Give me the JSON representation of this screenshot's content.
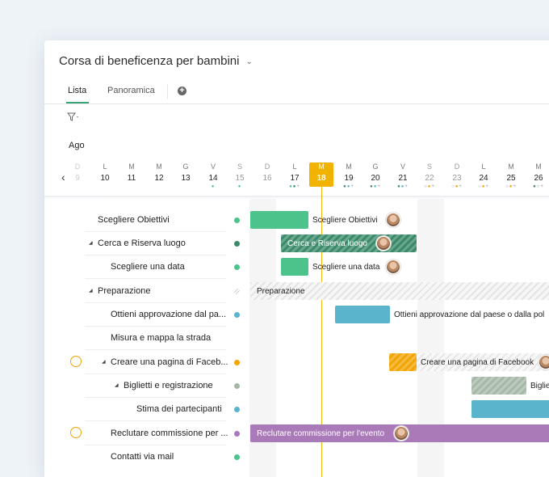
{
  "header": {
    "title": "Corsa di beneficenza per bambini"
  },
  "tabs": [
    {
      "label": "Lista"
    },
    {
      "label": "Panoramica"
    }
  ],
  "toolbar": {
    "filter_icon": "filter-icon",
    "add_icon": "plus-icon"
  },
  "timeline": {
    "month": "Ago",
    "today_color": "#f2b200",
    "days": [
      {
        "letter": "D",
        "num": "9"
      },
      {
        "letter": "L",
        "num": "10"
      },
      {
        "letter": "M",
        "num": "11"
      },
      {
        "letter": "M",
        "num": "12"
      },
      {
        "letter": "G",
        "num": "13"
      },
      {
        "letter": "V",
        "num": "14"
      },
      {
        "letter": "S",
        "num": "15"
      },
      {
        "letter": "D",
        "num": "16"
      },
      {
        "letter": "L",
        "num": "17"
      },
      {
        "letter": "M",
        "num": "18"
      },
      {
        "letter": "M",
        "num": "19"
      },
      {
        "letter": "G",
        "num": "20"
      },
      {
        "letter": "V",
        "num": "21"
      },
      {
        "letter": "S",
        "num": "22"
      },
      {
        "letter": "D",
        "num": "23"
      },
      {
        "letter": "L",
        "num": "24"
      },
      {
        "letter": "M",
        "num": "25"
      },
      {
        "letter": "M",
        "num": "26"
      }
    ]
  },
  "tasks": [
    {
      "name": "Scegliere Obiettivi",
      "status_color": "#4cc38a",
      "bar_label": "Scegliere Obiettivi"
    },
    {
      "name": "Cerca e Riserva luogo",
      "status_color": "#3a8a6a",
      "bar_label": "Cerca e Riserva luogo"
    },
    {
      "name": "Scegliere una data",
      "status_color": "#4cc38a",
      "bar_label": "Scegliere una data"
    },
    {
      "name": "Preparazione",
      "status_color": "#e6e6e6",
      "bar_label": "Preparazione"
    },
    {
      "name": "Ottieni approvazione dal pa...",
      "status_color": "#5ab4cc",
      "bar_label": "Ottieni approvazione dal paese o dalla pol"
    },
    {
      "name": "Misura e mappa la strada",
      "status_color": "",
      "bar_label": ""
    },
    {
      "name": "Creare una pagina di Faceb...",
      "status_color": "#f2a400",
      "bar_label": "Creare una pagina di Facebook"
    },
    {
      "name": "Biglietti e registrazione",
      "status_color": "#a5b8a8",
      "bar_label": "Biglie"
    },
    {
      "name": "Stima dei partecipanti",
      "status_color": "#5ab4cc",
      "bar_label": ""
    },
    {
      "name": "Reclutare commissione per ...",
      "status_color": "#a979b8",
      "bar_label": "Reclutare commissione per l'evento"
    },
    {
      "name": "Contatti via mail",
      "status_color": "#4cc38a",
      "bar_label": ""
    }
  ]
}
